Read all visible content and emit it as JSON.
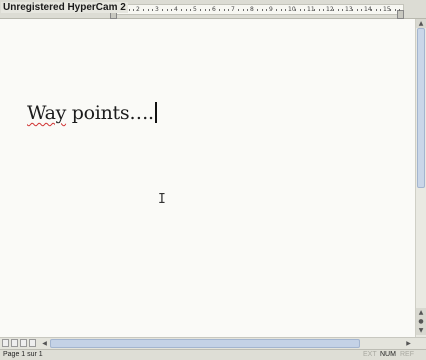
{
  "watermark": "Unregistered HyperCam 2",
  "ruler": {
    "numbers": [
      "1",
      "2",
      "3",
      "4",
      "5",
      "6",
      "7",
      "8",
      "9",
      "10",
      "11",
      "12",
      "13",
      "14",
      "15"
    ]
  },
  "document": {
    "word1": "Way",
    "word2": "points",
    "ellipsis": "…."
  },
  "pointer_icon": "I",
  "statusbar": {
    "page": "Page 1 sur 1",
    "indicators": [
      {
        "label": "EXT",
        "active": false
      },
      {
        "label": "NUM",
        "active": true
      },
      {
        "label": "REF",
        "active": false
      }
    ]
  }
}
